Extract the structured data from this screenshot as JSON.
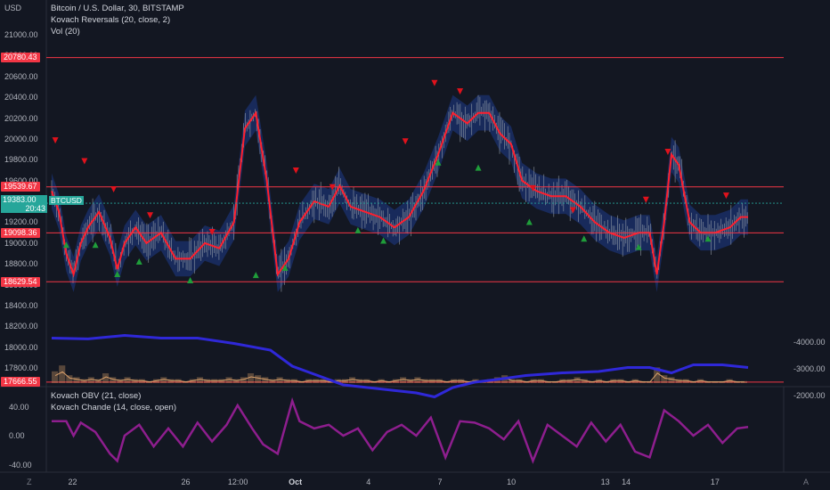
{
  "chart_data": {
    "type": "line",
    "title": "Bitcoin / U.S. Dollar, 30, BITSTAMP",
    "currency_label": "USD",
    "indicators": [
      "Kovach Reversals (20, close, 2)",
      "Vol (20)"
    ],
    "price_axis": {
      "ticks": [
        "21000.00",
        "20800.00",
        "20600.00",
        "20400.00",
        "20200.00",
        "20000.00",
        "19800.00",
        "19600.00",
        "19400.00",
        "19200.00",
        "19000.00",
        "18800.00",
        "18600.00",
        "18400.00",
        "18200.00",
        "18000.00",
        "17800.00"
      ],
      "ylim": [
        17640,
        21230
      ]
    },
    "x_ticks": [
      "22",
      "26",
      "12:00",
      "Oct",
      "4",
      "7",
      "10",
      "13",
      "14",
      "17"
    ],
    "horizontal_levels": [
      {
        "value": 20780.43,
        "label": "20780.43"
      },
      {
        "value": 19539.67,
        "label": "19539.67"
      },
      {
        "value": 19098.36,
        "label": "19098.36"
      },
      {
        "value": 18629.54,
        "label": "18629.54"
      },
      {
        "value": 17666.55,
        "label": "17666.55"
      }
    ],
    "last_price": {
      "value": 19383.0,
      "label": "19383.00",
      "countdown": "20:43",
      "symbol": "BTCUSD"
    },
    "price_series": [
      {
        "x": 0,
        "y": 19500
      },
      {
        "x": 2,
        "y": 19300
      },
      {
        "x": 4,
        "y": 18900
      },
      {
        "x": 6,
        "y": 18700
      },
      {
        "x": 8,
        "y": 19000
      },
      {
        "x": 10,
        "y": 19150
      },
      {
        "x": 13,
        "y": 19300
      },
      {
        "x": 16,
        "y": 19050
      },
      {
        "x": 18,
        "y": 18750
      },
      {
        "x": 20,
        "y": 19000
      },
      {
        "x": 23,
        "y": 19150
      },
      {
        "x": 26,
        "y": 19000
      },
      {
        "x": 30,
        "y": 19100
      },
      {
        "x": 34,
        "y": 18850
      },
      {
        "x": 38,
        "y": 18850
      },
      {
        "x": 42,
        "y": 19000
      },
      {
        "x": 46,
        "y": 18950
      },
      {
        "x": 50,
        "y": 19200
      },
      {
        "x": 53,
        "y": 20100
      },
      {
        "x": 56,
        "y": 20250
      },
      {
        "x": 59,
        "y": 19600
      },
      {
        "x": 62,
        "y": 18700
      },
      {
        "x": 65,
        "y": 18850
      },
      {
        "x": 68,
        "y": 19200
      },
      {
        "x": 72,
        "y": 19400
      },
      {
        "x": 76,
        "y": 19350
      },
      {
        "x": 79,
        "y": 19550
      },
      {
        "x": 82,
        "y": 19350
      },
      {
        "x": 86,
        "y": 19300
      },
      {
        "x": 90,
        "y": 19250
      },
      {
        "x": 94,
        "y": 19150
      },
      {
        "x": 98,
        "y": 19250
      },
      {
        "x": 102,
        "y": 19500
      },
      {
        "x": 106,
        "y": 19850
      },
      {
        "x": 110,
        "y": 20250
      },
      {
        "x": 114,
        "y": 20150
      },
      {
        "x": 117,
        "y": 20250
      },
      {
        "x": 120,
        "y": 20250
      },
      {
        "x": 123,
        "y": 20050
      },
      {
        "x": 126,
        "y": 19950
      },
      {
        "x": 129,
        "y": 19600
      },
      {
        "x": 133,
        "y": 19500
      },
      {
        "x": 137,
        "y": 19450
      },
      {
        "x": 141,
        "y": 19450
      },
      {
        "x": 145,
        "y": 19350
      },
      {
        "x": 149,
        "y": 19200
      },
      {
        "x": 153,
        "y": 19100
      },
      {
        "x": 157,
        "y": 19050
      },
      {
        "x": 161,
        "y": 19100
      },
      {
        "x": 164,
        "y": 19100
      },
      {
        "x": 166,
        "y": 18700
      },
      {
        "x": 168,
        "y": 19200
      },
      {
        "x": 170,
        "y": 19850
      },
      {
        "x": 172,
        "y": 19750
      },
      {
        "x": 175,
        "y": 19200
      },
      {
        "x": 178,
        "y": 19100
      },
      {
        "x": 182,
        "y": 19100
      },
      {
        "x": 186,
        "y": 19150
      },
      {
        "x": 189,
        "y": 19250
      },
      {
        "x": 191,
        "y": 19250
      }
    ],
    "buy_markers": [
      {
        "x": 4,
        "y": 18980
      },
      {
        "x": 12,
        "y": 18980
      },
      {
        "x": 18,
        "y": 18700
      },
      {
        "x": 24,
        "y": 18820
      },
      {
        "x": 38,
        "y": 18640
      },
      {
        "x": 56,
        "y": 18690
      },
      {
        "x": 64,
        "y": 18760
      },
      {
        "x": 84,
        "y": 19120
      },
      {
        "x": 91,
        "y": 19020
      },
      {
        "x": 106,
        "y": 19770
      },
      {
        "x": 117,
        "y": 19720
      },
      {
        "x": 131,
        "y": 19200
      },
      {
        "x": 146,
        "y": 19040
      },
      {
        "x": 161,
        "y": 18960
      },
      {
        "x": 180,
        "y": 19040
      }
    ],
    "sell_markers": [
      {
        "x": 1,
        "y": 19990
      },
      {
        "x": 9,
        "y": 19790
      },
      {
        "x": 17,
        "y": 19520
      },
      {
        "x": 27,
        "y": 19270
      },
      {
        "x": 44,
        "y": 19110
      },
      {
        "x": 67,
        "y": 19700
      },
      {
        "x": 77,
        "y": 19540
      },
      {
        "x": 97,
        "y": 19980
      },
      {
        "x": 105,
        "y": 20540
      },
      {
        "x": 112,
        "y": 20460
      },
      {
        "x": 132,
        "y": 19530
      },
      {
        "x": 143,
        "y": 19320
      },
      {
        "x": 163,
        "y": 19420
      },
      {
        "x": 169,
        "y": 19880
      },
      {
        "x": 185,
        "y": 19460
      }
    ],
    "volume": [
      0.6,
      0.9,
      0.4,
      0.3,
      0.2,
      0.3,
      0.2,
      0.5,
      0.3,
      0.2,
      0.3,
      0.2,
      0.2,
      0.1,
      0.2,
      0.3,
      0.2,
      0.2,
      0.1,
      0.2,
      0.3,
      0.2,
      0.2,
      0.2,
      0.3,
      0.2,
      0.3,
      0.5,
      0.4,
      0.3,
      0.2,
      0.3,
      0.2,
      0.2,
      0.1,
      0.2,
      0.2,
      0.2,
      0.1,
      0.2,
      0.2,
      0.3,
      0.2,
      0.2,
      0.1,
      0.2,
      0.1,
      0.2,
      0.3,
      0.2,
      0.3,
      0.2,
      0.2,
      0.2,
      0.1,
      0.2,
      0.2,
      0.1,
      0.2,
      0.1,
      0.2,
      0.3,
      0.4,
      0.2,
      0.2,
      0.1,
      0.2,
      0.2,
      0.1,
      0.1,
      0.2,
      0.2,
      0.3,
      0.2,
      0.1,
      0.2,
      0.1,
      0.2,
      0.2,
      0.1,
      0.2,
      0.1,
      0.1,
      0.8,
      0.4,
      0.3,
      0.2,
      0.2,
      0.1,
      0.2,
      0.1,
      0.1,
      0.1,
      0.2,
      0.1,
      0.1
    ],
    "oscillator_pane": {
      "legend": [
        "Kovach OBV (21, close)",
        "Kovach Chande (14, close, open)"
      ],
      "left_ticks": [
        "40.00",
        "0.00",
        "-40.00"
      ],
      "right_ticks": [
        "-2000.00",
        "-3000.00",
        "-4000.00"
      ],
      "chande": [
        {
          "x": 0,
          "y": 20
        },
        {
          "x": 4,
          "y": 20
        },
        {
          "x": 6,
          "y": 0
        },
        {
          "x": 8,
          "y": 18
        },
        {
          "x": 12,
          "y": 5
        },
        {
          "x": 16,
          "y": -25
        },
        {
          "x": 18,
          "y": -35
        },
        {
          "x": 20,
          "y": 0
        },
        {
          "x": 24,
          "y": 15
        },
        {
          "x": 28,
          "y": -15
        },
        {
          "x": 32,
          "y": 10
        },
        {
          "x": 36,
          "y": -15
        },
        {
          "x": 40,
          "y": 18
        },
        {
          "x": 44,
          "y": -8
        },
        {
          "x": 48,
          "y": 15
        },
        {
          "x": 51,
          "y": 42
        },
        {
          "x": 55,
          "y": 10
        },
        {
          "x": 58,
          "y": -12
        },
        {
          "x": 62,
          "y": -25
        },
        {
          "x": 66,
          "y": 48
        },
        {
          "x": 68,
          "y": 20
        },
        {
          "x": 72,
          "y": 10
        },
        {
          "x": 76,
          "y": 15
        },
        {
          "x": 80,
          "y": 0
        },
        {
          "x": 84,
          "y": 10
        },
        {
          "x": 88,
          "y": -20
        },
        {
          "x": 92,
          "y": 5
        },
        {
          "x": 96,
          "y": 15
        },
        {
          "x": 100,
          "y": 0
        },
        {
          "x": 104,
          "y": 25
        },
        {
          "x": 108,
          "y": -30
        },
        {
          "x": 112,
          "y": 20
        },
        {
          "x": 116,
          "y": 18
        },
        {
          "x": 120,
          "y": 10
        },
        {
          "x": 124,
          "y": -5
        },
        {
          "x": 128,
          "y": 20
        },
        {
          "x": 132,
          "y": -35
        },
        {
          "x": 136,
          "y": 15
        },
        {
          "x": 140,
          "y": 0
        },
        {
          "x": 144,
          "y": -15
        },
        {
          "x": 148,
          "y": 18
        },
        {
          "x": 152,
          "y": -8
        },
        {
          "x": 156,
          "y": 15
        },
        {
          "x": 160,
          "y": -22
        },
        {
          "x": 164,
          "y": -30
        },
        {
          "x": 168,
          "y": 35
        },
        {
          "x": 172,
          "y": 20
        },
        {
          "x": 176,
          "y": 0
        },
        {
          "x": 180,
          "y": 15
        },
        {
          "x": 184,
          "y": -10
        },
        {
          "x": 188,
          "y": 10
        },
        {
          "x": 191,
          "y": 12
        }
      ],
      "obv": [
        {
          "x": 0,
          "y": -4150
        },
        {
          "x": 10,
          "y": -4120
        },
        {
          "x": 20,
          "y": -4250
        },
        {
          "x": 30,
          "y": -4150
        },
        {
          "x": 40,
          "y": -4150
        },
        {
          "x": 50,
          "y": -3950
        },
        {
          "x": 60,
          "y": -3700
        },
        {
          "x": 66,
          "y": -3100
        },
        {
          "x": 72,
          "y": -2800
        },
        {
          "x": 80,
          "y": -2400
        },
        {
          "x": 90,
          "y": -2250
        },
        {
          "x": 100,
          "y": -2100
        },
        {
          "x": 105,
          "y": -1950
        },
        {
          "x": 110,
          "y": -2300
        },
        {
          "x": 116,
          "y": -2500
        },
        {
          "x": 122,
          "y": -2600
        },
        {
          "x": 130,
          "y": -2750
        },
        {
          "x": 140,
          "y": -2850
        },
        {
          "x": 150,
          "y": -2900
        },
        {
          "x": 158,
          "y": -3050
        },
        {
          "x": 164,
          "y": -3050
        },
        {
          "x": 170,
          "y": -2850
        },
        {
          "x": 176,
          "y": -3150
        },
        {
          "x": 184,
          "y": -3150
        },
        {
          "x": 191,
          "y": -3050
        }
      ]
    }
  },
  "colors": {
    "background": "#131722",
    "level_line": "#f23645",
    "candles": "#9aa3ad",
    "kovach_line": "#ff1f2e",
    "band": "#1e3a8a",
    "buy": "#1f9d3a",
    "sell": "#e0121c",
    "volume": "#d9a06b",
    "chande": "#8e1e8e",
    "obv": "#2f28d8",
    "last_tag": "#26a69a"
  }
}
